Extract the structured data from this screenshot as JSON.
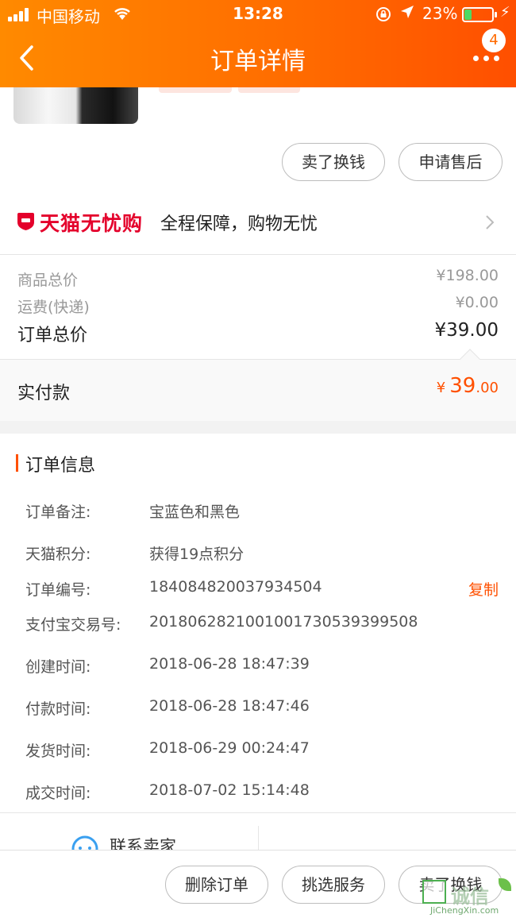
{
  "status_bar": {
    "carrier": "中国移动",
    "time": "13:28",
    "battery_percent": "23%",
    "battery_level": 0.23
  },
  "nav": {
    "title": "订单详情",
    "message_badge": "4",
    "icons": [
      "back-icon",
      "more-icon"
    ]
  },
  "actions_top": {
    "sell_label": "卖了换钱",
    "after_sale_label": "申请售后"
  },
  "tmall": {
    "brand": "天猫无忧购",
    "slogan": "全程保障，购物无忧",
    "brand_color": "#e4002b"
  },
  "prices": {
    "goods_total_label": "商品总价",
    "goods_total": "¥198.00",
    "shipping_label": "运费(快递)",
    "shipping": "¥0.00",
    "order_total_label": "订单总价",
    "order_total": "¥39.00",
    "paid_label": "实付款",
    "paid_currency": "¥",
    "paid_int": "39",
    "paid_dec": ".00"
  },
  "order_info": {
    "title": "订单信息",
    "rows": [
      {
        "label": "订单备注:",
        "value": "宝蓝色和黑色"
      },
      {
        "label": "天猫积分:",
        "value": "获得19点积分"
      },
      {
        "label": "订单编号:",
        "value": "184084820037934504"
      },
      {
        "label": "支付宝交易号:",
        "value": "2018062821001001730539399508"
      },
      {
        "label": "创建时间:",
        "value": "2018-06-28 18:47:39"
      },
      {
        "label": "付款时间:",
        "value": "2018-06-28 18:47:46"
      },
      {
        "label": "发货时间:",
        "value": "2018-06-29 00:24:47"
      },
      {
        "label": "成交时间:",
        "value": "2018-07-02 15:14:48"
      }
    ],
    "copy_label": "复制",
    "contact_seller": "联系卖家"
  },
  "bottom_actions": {
    "delete_label": "删除订单",
    "service_label": "挑选服务",
    "sell_label": "卖了换钱"
  },
  "watermark": {
    "text": "诚信",
    "url": "JiChengXin.com"
  },
  "colors": {
    "accent": "#ff5000",
    "header_start": "#ff8a00",
    "header_end": "#ff4f00"
  }
}
